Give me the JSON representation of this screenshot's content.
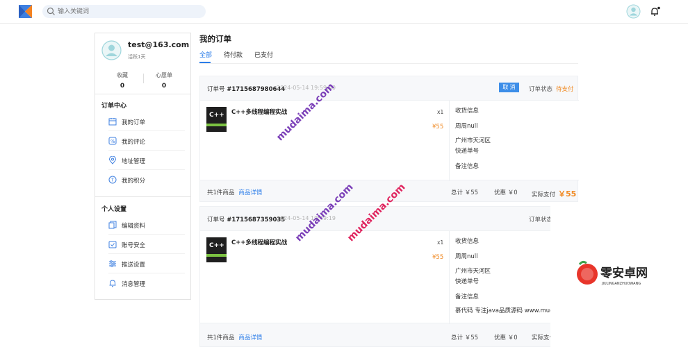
{
  "header": {
    "search_placeholder": "输入关键词"
  },
  "profile": {
    "email": "test@163.com",
    "level": "活跃1天",
    "stats": [
      {
        "label": "收藏",
        "value": "0"
      },
      {
        "label": "心愿单",
        "value": "0"
      }
    ]
  },
  "sidebar": {
    "order_center_title": "订单中心",
    "order_items": [
      {
        "label": "我的订单",
        "icon": "calendar-icon"
      },
      {
        "label": "我的评论",
        "icon": "comment-icon"
      },
      {
        "label": "地址管理",
        "icon": "location-icon"
      },
      {
        "label": "我的积分",
        "icon": "points-icon"
      }
    ],
    "personal_title": "个人设置",
    "personal_items": [
      {
        "label": "编辑资料",
        "icon": "copy-icon"
      },
      {
        "label": "账号安全",
        "icon": "shield-icon"
      },
      {
        "label": "推送设置",
        "icon": "sliders-icon"
      },
      {
        "label": "消息管理",
        "icon": "bell-icon"
      }
    ]
  },
  "main": {
    "title": "我的订单",
    "tabs": [
      {
        "label": "全部",
        "active": true
      },
      {
        "label": "待付款",
        "active": false
      },
      {
        "label": "已支付",
        "active": false
      }
    ]
  },
  "orders": [
    {
      "order_no_label": "订单号",
      "order_no": "#1715687980644",
      "date": "2024-05-14 19:59:40",
      "cancel_label": "取 消",
      "status_label": "订单状态",
      "status_value": "待支付",
      "product_name": "C++多线程编程实战",
      "qty": "x1",
      "price": "¥55",
      "info": [
        "收货信息",
        "周周null",
        "广州市天河区",
        "快递单号",
        "备注信息"
      ],
      "count_text": "共1件商品",
      "detail_link": "商品详情",
      "total_text": "总计 ￥55",
      "discount_text": "优惠 ￥0",
      "paid_label": "实际支付",
      "paid_value": "￥55"
    },
    {
      "order_no_label": "订单号",
      "order_no": "#1715687359035",
      "date": "2024-05-14 19:49:19",
      "status_label": "订单状态",
      "product_name": "C++多线程编程实战",
      "qty": "x1",
      "price": "¥55",
      "info": [
        "收货信息",
        "周周null",
        "广州市天河区",
        "快递单号",
        "备注信息",
        "慕代码 专注java品质源码 www.mudaima.com"
      ],
      "count_text": "共1件商品",
      "detail_link": "商品详情",
      "total_text": "总计 ￥55",
      "discount_text": "优惠 ￥0",
      "paid_label": "实际支付"
    }
  ],
  "watermarks": [
    "mudaima.com",
    "mudaima.com",
    "mudaima.com"
  ],
  "brand": {
    "name": "零安卓网",
    "sub": "JIULINGANZHUOWANG"
  },
  "colors": {
    "accent": "#2b7de9",
    "price": "#f08a24",
    "watermark": "#7b3fb8",
    "watermark2": "#e0245e"
  }
}
